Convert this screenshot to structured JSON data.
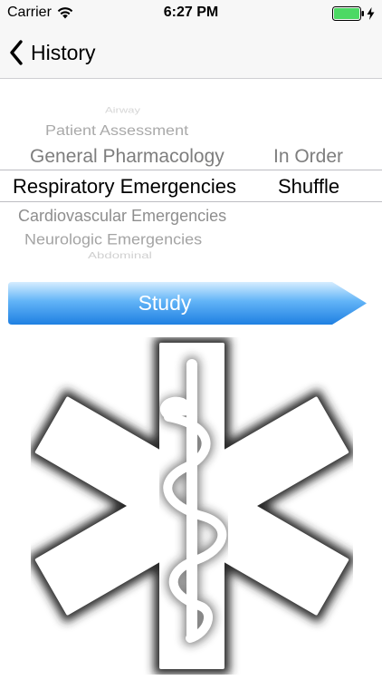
{
  "status_bar": {
    "carrier": "Carrier",
    "time": "6:27 PM",
    "wifi_icon": "wifi-icon",
    "battery_icon": "battery-full-icon",
    "charge_icon": "charging-bolt-icon",
    "battery_color": "#4cd964"
  },
  "nav": {
    "back_label": "History",
    "back_icon": "chevron-left-icon"
  },
  "picker": {
    "topics": [
      "Airway",
      "Patient Assessment",
      "General Pharmacology",
      "Respiratory Emergencies",
      "Cardiovascular Emergencies",
      "Neurologic Emergencies",
      "Abdominal"
    ],
    "selected_topic": "Respiratory Emergencies",
    "orders": [
      "In Order",
      "Shuffle"
    ],
    "selected_order": "Shuffle"
  },
  "study_button": {
    "label": "Study",
    "color_light": "#c8e6ff",
    "color_mid": "#4aa8f5",
    "color_dark": "#1d7fe0"
  },
  "emblem": {
    "icon": "star-of-life-icon"
  }
}
